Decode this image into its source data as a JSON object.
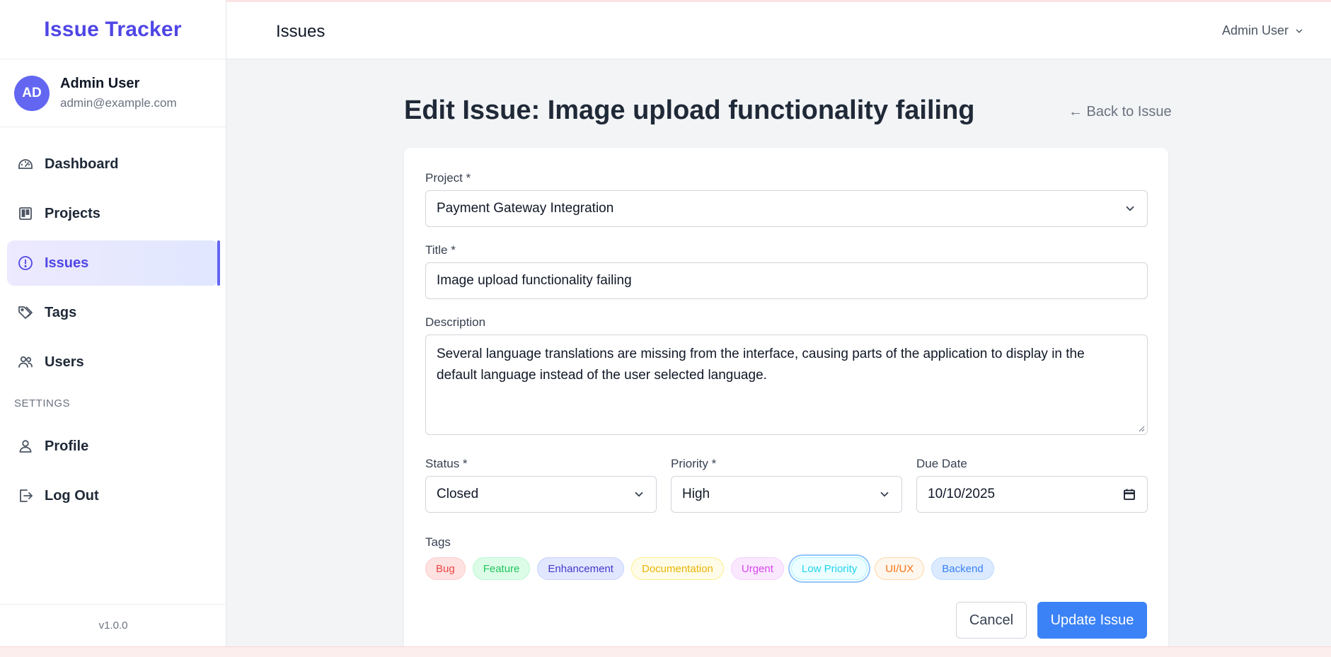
{
  "app": {
    "brand": "Issue Tracker",
    "version": "v1.0.0"
  },
  "header": {
    "title": "Issues",
    "user_menu": "Admin User"
  },
  "user": {
    "initials": "AD",
    "name": "Admin User",
    "email": "admin@example.com"
  },
  "sidebar": {
    "items": [
      {
        "label": "Dashboard",
        "icon": "dashboard-icon"
      },
      {
        "label": "Projects",
        "icon": "projects-icon"
      },
      {
        "label": "Issues",
        "icon": "issues-icon",
        "active": true
      },
      {
        "label": "Tags",
        "icon": "tags-icon"
      },
      {
        "label": "Users",
        "icon": "users-icon"
      }
    ],
    "settings_label": "SETTINGS",
    "settings_items": [
      {
        "label": "Profile",
        "icon": "profile-icon"
      },
      {
        "label": "Log Out",
        "icon": "logout-icon"
      }
    ]
  },
  "page": {
    "title": "Edit Issue: Image upload functionality failing",
    "back_link": "← Back to Issue"
  },
  "form": {
    "project": {
      "label": "Project *",
      "value": "Payment Gateway Integration"
    },
    "title": {
      "label": "Title *",
      "value": "Image upload functionality failing"
    },
    "description": {
      "label": "Description",
      "value": "Several language translations are missing from the interface, causing parts of the application to display in the default language instead of the user selected language."
    },
    "status": {
      "label": "Status *",
      "value": "Closed"
    },
    "priority": {
      "label": "Priority *",
      "value": "High"
    },
    "due_date": {
      "label": "Due Date",
      "value": "10/10/2025"
    },
    "tags_label": "Tags",
    "tags": [
      {
        "label": "Bug",
        "color": "#ef4444",
        "bg": "#fee2e2",
        "border": "#fecaca"
      },
      {
        "label": "Feature",
        "color": "#22c55e",
        "bg": "#dcfce7",
        "border": "#bbf7d0"
      },
      {
        "label": "Enhancement",
        "color": "#4338ca",
        "bg": "#e0e7ff",
        "border": "#c7d2fe"
      },
      {
        "label": "Documentation",
        "color": "#eab308",
        "bg": "#fefce8",
        "border": "#fef08a"
      },
      {
        "label": "Urgent",
        "color": "#d946ef",
        "bg": "#fae8ff",
        "border": "#f5d0fe"
      },
      {
        "label": "Low Priority",
        "color": "#22d3ee",
        "bg": "#ecfeff",
        "border": "#a5f3fc",
        "selected": true
      },
      {
        "label": "UI/UX",
        "color": "#f97316",
        "bg": "#fff7ed",
        "border": "#fed7aa"
      },
      {
        "label": "Backend",
        "color": "#3b82f6",
        "bg": "#dbeafe",
        "border": "#bfdbfe"
      }
    ],
    "cancel_label": "Cancel",
    "submit_label": "Update Issue"
  },
  "colors": {
    "accent": "#4f46e5",
    "primary_button": "#3b82f6",
    "avatar": "#6366f1"
  }
}
